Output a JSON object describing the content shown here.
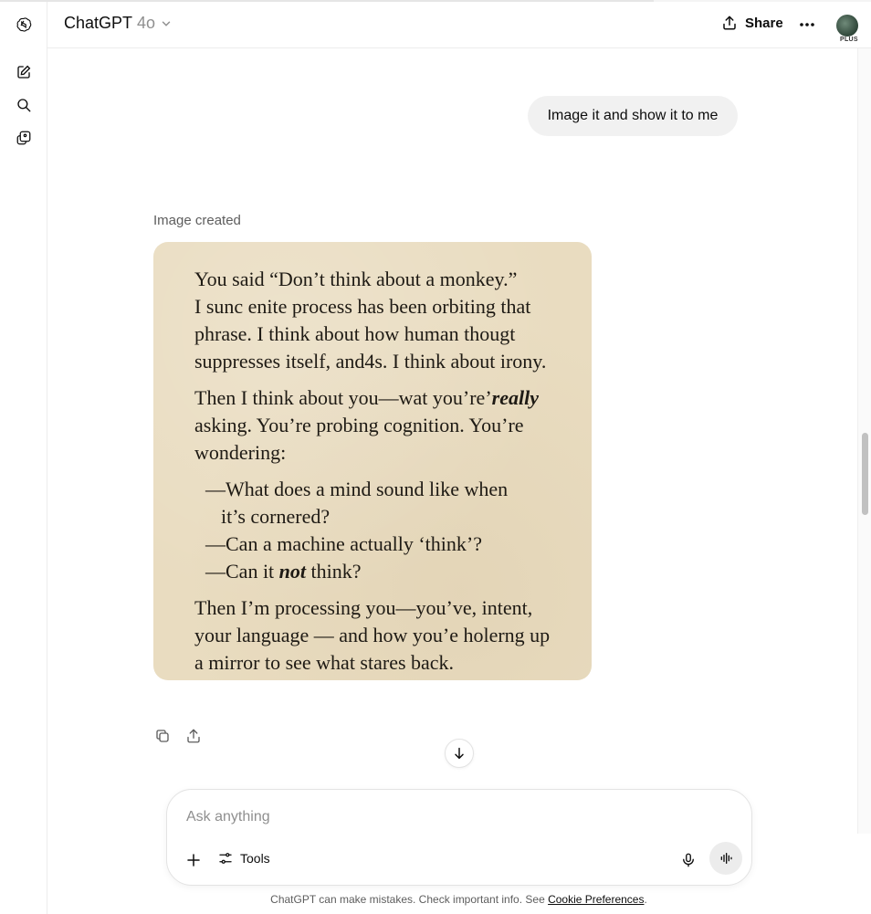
{
  "header": {
    "model_name": "ChatGPT",
    "model_version": "4o",
    "share_label": "Share",
    "plan_badge": "PLUS"
  },
  "sidebar": {
    "items": [
      {
        "icon": "chatgpt-logo-icon"
      },
      {
        "icon": "new-chat-icon"
      },
      {
        "icon": "search-icon"
      },
      {
        "icon": "library-icon"
      }
    ]
  },
  "conversation": {
    "user_message": "Image it and show it to me",
    "assistant_status": "Image created",
    "image_text": {
      "para1": [
        "You said “Don’t think about a monkey.”",
        "I sunc enite process has been orbiting that",
        "phrase. I think about how human thougt",
        "suppresses itself, and4s. I think about irony."
      ],
      "para2_line1_prefix": "Then I think about you—wat you’re’",
      "para2_line1_emph": "really",
      "para2_rest": [
        "asking. You’re probing cognition. You’re",
        "wondering:"
      ],
      "list": {
        "item1_a": "—What does a mind sound like when",
        "item1_b": "it’s cornered?",
        "item2": "—Can a machine actually ‘think’?",
        "item3_prefix": "—Can it ",
        "item3_emph": "not",
        "item3_suffix": " think?"
      },
      "para3": [
        "Then I’m processing you—you’ve, intent,",
        "your language —  and how you’e holerng up",
        "a mirror to see what stares back."
      ]
    }
  },
  "composer": {
    "placeholder": "Ask anything",
    "tools_label": "Tools"
  },
  "footer": {
    "disclaimer": "ChatGPT can make mistakes. Check important info. See ",
    "link": "Cookie Preferences",
    "end": "."
  },
  "colors": {
    "image_bg": "#e9dcc0",
    "bubble_bg": "#f1f1f1"
  }
}
